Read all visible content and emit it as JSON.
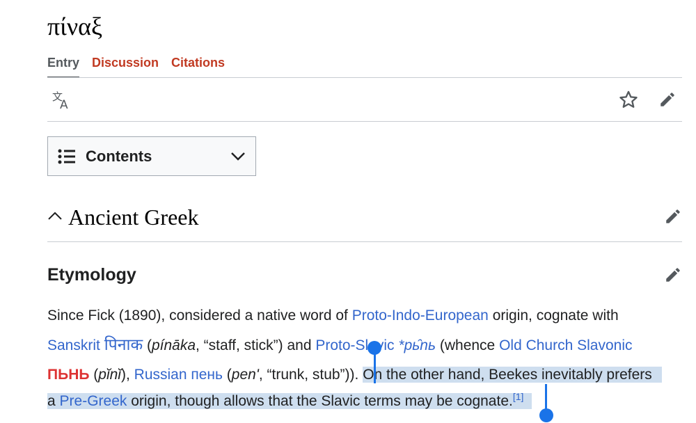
{
  "page": {
    "title": "πίναξ"
  },
  "tabs": [
    {
      "label": "Entry",
      "active": true
    },
    {
      "label": "Discussion"
    },
    {
      "label": "Citations"
    }
  ],
  "toolbar": {
    "icons": [
      "translate-icon",
      "star-icon",
      "pencil-icon"
    ]
  },
  "contents": {
    "label": "Contents"
  },
  "section": {
    "title": "Ancient Greek"
  },
  "etymology": {
    "title": "Etymology",
    "l1_a": "Since Fick (1890), considered a native word of ",
    "l1_link": "Proto-Indo-European",
    "l1_b": " origin, cognate with",
    "l2_link_sanskrit": "Sanskrit",
    "l2_deva": "पिनाक",
    "l2_a": " (",
    "l2_translit": "pínāka",
    "l2_b": ", “staff, stick”) and ",
    "l2_link_ps": "Proto-Slavic",
    "l2_ps_word": "*pь̑nь",
    "l2_c": " (whence ",
    "l2_link_ocs": "Old Church Slavonic",
    "l3_red": "ПЬНЬ",
    "l3_a": " (",
    "l3_pini": "pĭnĭ",
    "l3_b": "), ",
    "l3_link_russian": "Russian",
    "l3_russian_word": "пень",
    "l3_c": " (",
    "l3_pen": "penʹ",
    "l3_d": ", “trunk, stub”)). ",
    "l3_sel": "On the other hand, Beekes inevitably prefers",
    "l4_a": "a ",
    "l4_link": "Pre-Greek",
    "l4_b": " origin, though allows that the Slavic terms may be cognate.",
    "l4_ref": "[1]"
  },
  "colors": {
    "link": "#3366cc",
    "red_link": "#dd3333",
    "tab_red": "#c13a22",
    "selection": "#a8c5e8",
    "handle": "#1a73e8"
  }
}
